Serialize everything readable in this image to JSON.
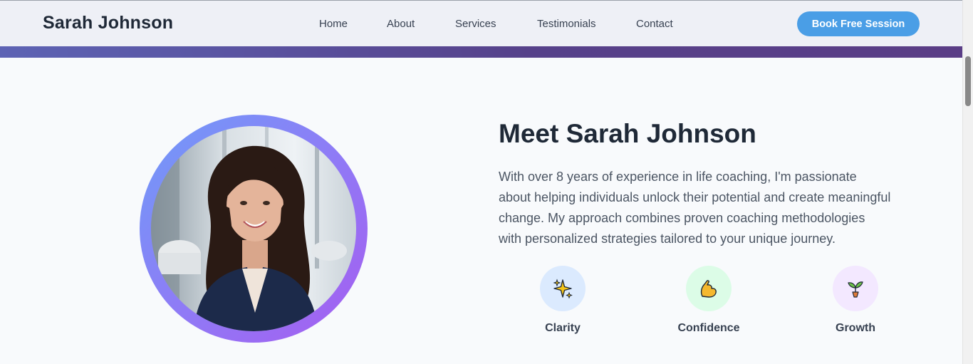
{
  "nav": {
    "brand": "Sarah Johnson",
    "links": [
      "Home",
      "About",
      "Services",
      "Testimonials",
      "Contact"
    ],
    "cta_label": "Book Free Session"
  },
  "about": {
    "heading": "Meet Sarah Johnson",
    "bio_lines": [
      "With over 8 years of experience in life coaching, I'm passionate",
      "about helping individuals unlock their potential and create meaningful",
      "change. My approach combines proven coaching methodologies",
      "with personalized strategies tailored to your unique journey."
    ],
    "portrait_icon": "portrait-photo",
    "features": [
      {
        "label": "Clarity",
        "icon": "sparkles-icon",
        "bg": "#dbeafe"
      },
      {
        "label": "Confidence",
        "icon": "flexed-bicep-icon",
        "bg": "#dcfce7"
      },
      {
        "label": "Growth",
        "icon": "seedling-icon",
        "bg": "#f3e8ff"
      }
    ]
  },
  "colors": {
    "accent": "#4a9ee6",
    "heading": "#1f2937",
    "ring_start": "#6f9cf8",
    "ring_end": "#a65cf0"
  }
}
